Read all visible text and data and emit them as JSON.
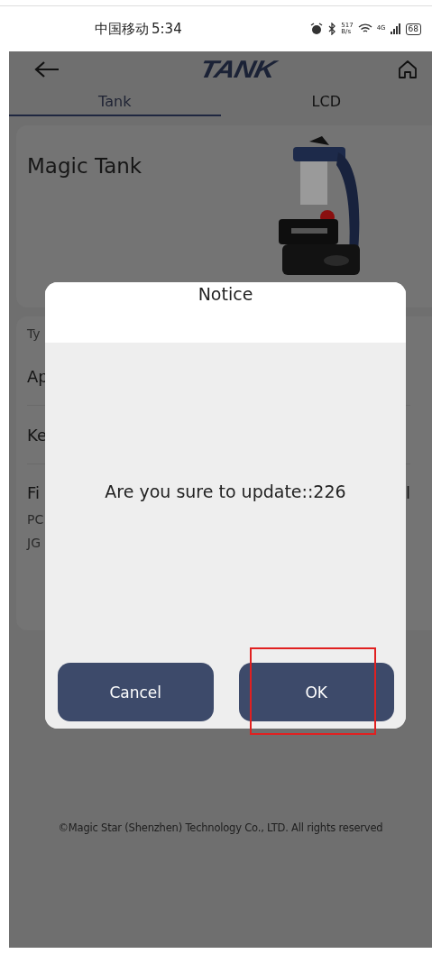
{
  "status_bar": {
    "carrier": "中国移动",
    "time": "5:34",
    "net_speed": "517",
    "net_speed_unit": "B/s",
    "network": "4G",
    "battery": "68"
  },
  "header": {
    "logo": "TANK"
  },
  "tabs": [
    {
      "label": "Tank",
      "selected": true
    },
    {
      "label": "LCD",
      "selected": false
    }
  ],
  "device_card": {
    "name": "Magic Tank"
  },
  "info_list": {
    "section_label": "Ty",
    "rows": [
      {
        "kind": "row",
        "label": "Ap"
      },
      {
        "kind": "row",
        "label": "Ke"
      },
      {
        "kind": "firmware",
        "label": "Fi",
        "value": "l",
        "lines": [
          "PC",
          "JG"
        ]
      }
    ]
  },
  "dialog": {
    "title": "Notice",
    "message": "Are you sure to update::226",
    "buttons": [
      {
        "label": "Cancel",
        "highlighted": false
      },
      {
        "label": "OK",
        "highlighted": true
      }
    ]
  },
  "footer": "©Magic Star (Shenzhen) Technology Co., LTD. All rights reserved"
}
